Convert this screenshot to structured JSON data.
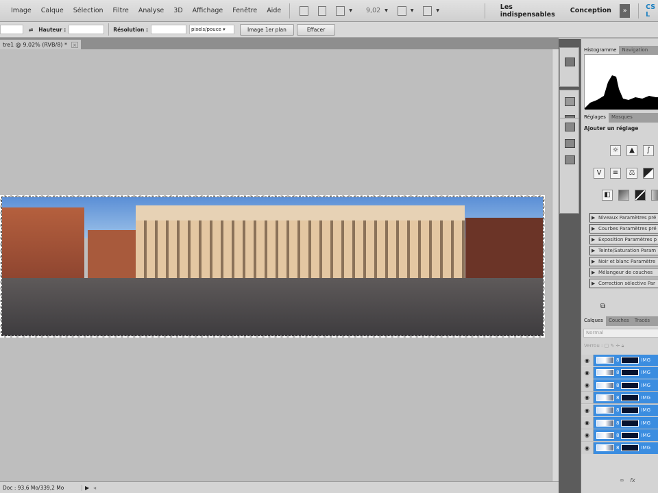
{
  "menubar": {
    "items": [
      "Image",
      "Calque",
      "Sélection",
      "Filtre",
      "Analyse",
      "3D",
      "Affichage",
      "Fenêtre",
      "Aide"
    ],
    "zoom": "9,02",
    "workspaces": [
      "Les indispensables",
      "Conception"
    ],
    "more": "»",
    "cslive": "CS L"
  },
  "options": {
    "height_label": "Hauteur :",
    "resolution_label": "Résolution :",
    "unit": "pixels/pouce",
    "front_image_button": "Image 1er plan",
    "clear_button": "Effacer"
  },
  "document": {
    "tab_title": "tre1 @ 9,02% (RVB/8) *",
    "close": "×"
  },
  "status": {
    "doc": "Doc : 93,6 Mo/339,2 Mo"
  },
  "panels": {
    "histogram_tabs": [
      "Histogramme",
      "Navigation"
    ],
    "adjust_tabs": [
      "Réglages",
      "Masques"
    ],
    "adjust_title": "Ajouter un réglage",
    "presets": [
      "Niveaux Paramètres pré",
      "Courbes Paramètres pré",
      "Exposition Paramètres p",
      "Teinte/Saturation Param",
      "Noir et blanc Paramètre",
      "Mélangeur de couches",
      "Correction sélective Par"
    ],
    "layers_tabs": [
      "Calques",
      "Couches",
      "Tracés"
    ],
    "blend_mode": "Normal",
    "lock_label": "Verrou :",
    "layers": [
      "IMG",
      "IMG",
      "IMG",
      "IMG",
      "IMG",
      "IMG",
      "IMG",
      "IMG"
    ]
  },
  "colors": {
    "selection": "#3b8de0"
  }
}
